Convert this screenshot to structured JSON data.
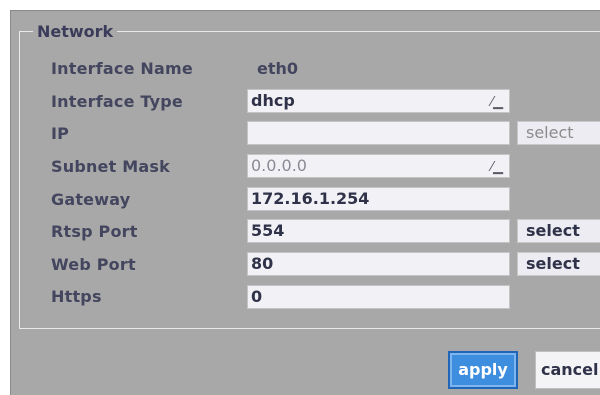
{
  "group_title": "Network",
  "rows": {
    "interface_name": {
      "label": "Interface Name",
      "value": "eth0"
    },
    "interface_type": {
      "label": "Interface Type",
      "value": "dhcp"
    },
    "ip": {
      "label": "IP",
      "value": "",
      "button": "select"
    },
    "subnet_mask": {
      "label": "Subnet Mask",
      "value": "0.0.0.0"
    },
    "gateway": {
      "label": "Gateway",
      "value": "172.16.1.254"
    },
    "rtsp_port": {
      "label": "Rtsp Port",
      "value": "554",
      "button": "select"
    },
    "web_port": {
      "label": "Web Port",
      "value": "80",
      "button": "select"
    },
    "https": {
      "label": "Https",
      "value": "0"
    }
  },
  "actions": {
    "apply": "apply",
    "cancel": "cancel"
  },
  "icons": {
    "combo_arrow": "dropdown-arrow-icon"
  },
  "colors": {
    "panel_bg": "#a8a8a8",
    "apply_bg": "#3e8ee0",
    "label_text": "#43465e"
  }
}
